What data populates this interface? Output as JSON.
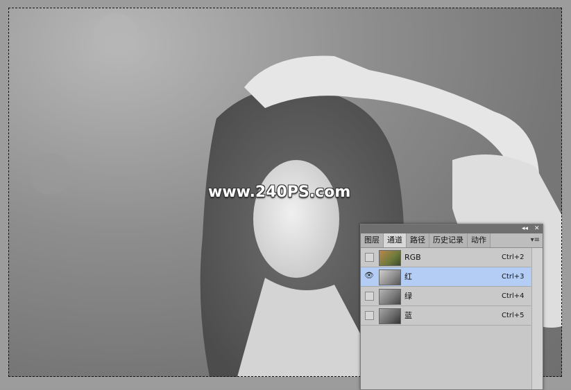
{
  "watermark": "www.240PS.com",
  "panel": {
    "collapse_icon": "double-arrow-right",
    "close_icon": "close",
    "tabs": [
      {
        "label": "图层",
        "active": false
      },
      {
        "label": "通道",
        "active": true
      },
      {
        "label": "路径",
        "active": false
      },
      {
        "label": "历史记录",
        "active": false
      },
      {
        "label": "动作",
        "active": false
      }
    ],
    "menu_label": "▾≡",
    "channels": [
      {
        "name": "RGB",
        "shortcut": "Ctrl+2",
        "visible": false,
        "selected": false
      },
      {
        "name": "红",
        "shortcut": "Ctrl+3",
        "visible": true,
        "selected": true
      },
      {
        "name": "绿",
        "shortcut": "Ctrl+4",
        "visible": false,
        "selected": false
      },
      {
        "name": "蓝",
        "shortcut": "Ctrl+5",
        "visible": false,
        "selected": false
      }
    ]
  },
  "colors": {
    "selected_row": "#b3cdf5"
  }
}
